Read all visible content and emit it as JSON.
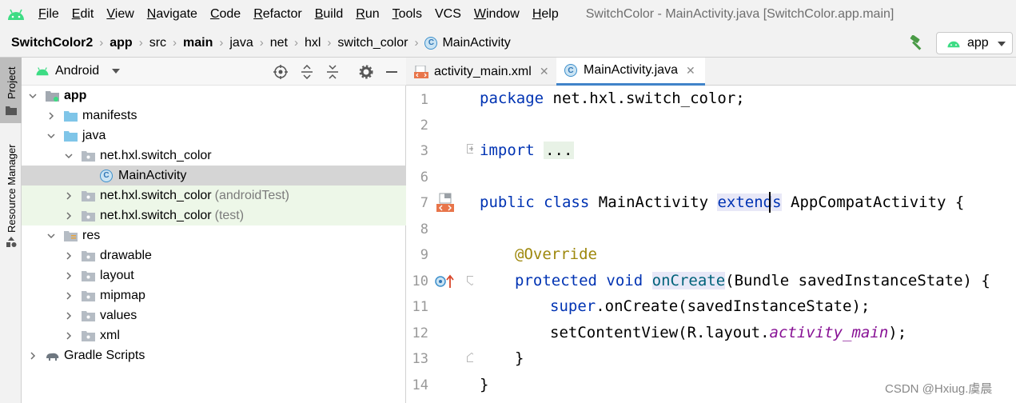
{
  "menubar": {
    "items": [
      "File",
      "Edit",
      "View",
      "Navigate",
      "Code",
      "Refactor",
      "Build",
      "Run",
      "Tools",
      "VCS",
      "Window",
      "Help"
    ],
    "mnemonics": [
      "F",
      "E",
      "V",
      "N",
      "C",
      "R",
      "B",
      "R",
      "T",
      "",
      "W",
      "H"
    ],
    "window_title": "SwitchColor - MainActivity.java [SwitchColor.app.main]"
  },
  "breadcrumb": {
    "items": [
      "SwitchColor2",
      "app",
      "src",
      "main",
      "java",
      "net",
      "hxl",
      "switch_color",
      "MainActivity"
    ],
    "run_config": "app"
  },
  "sidestrip": {
    "project": "Project",
    "resource_manager": "Resource Manager"
  },
  "project_panel": {
    "view": "Android",
    "tree": [
      {
        "label": "app",
        "suffix": "",
        "type": "module",
        "expanded": true
      },
      {
        "label": "manifests",
        "suffix": "",
        "type": "folder",
        "expanded": false
      },
      {
        "label": "java",
        "suffix": "",
        "type": "folder",
        "expanded": true
      },
      {
        "label": "net.hxl.switch_color",
        "suffix": "",
        "type": "package",
        "expanded": true
      },
      {
        "label": "MainActivity",
        "suffix": "",
        "type": "class",
        "selected": true
      },
      {
        "label": "net.hxl.switch_color",
        "suffix": "(androidTest)",
        "type": "package",
        "expanded": false
      },
      {
        "label": "net.hxl.switch_color",
        "suffix": "(test)",
        "type": "package",
        "expanded": false
      },
      {
        "label": "res",
        "suffix": "",
        "type": "res",
        "expanded": true
      },
      {
        "label": "drawable",
        "suffix": "",
        "type": "package",
        "expanded": false
      },
      {
        "label": "layout",
        "suffix": "",
        "type": "package",
        "expanded": false
      },
      {
        "label": "mipmap",
        "suffix": "",
        "type": "package",
        "expanded": false
      },
      {
        "label": "values",
        "suffix": "",
        "type": "package",
        "expanded": false
      },
      {
        "label": "xml",
        "suffix": "",
        "type": "package",
        "expanded": false
      },
      {
        "label": "Gradle Scripts",
        "suffix": "",
        "type": "gradle",
        "expanded": false
      }
    ]
  },
  "editor": {
    "tabs": [
      {
        "label": "activity_main.xml",
        "active": false
      },
      {
        "label": "MainActivity.java",
        "active": true
      }
    ],
    "line_numbers": [
      "1",
      "2",
      "3",
      "6",
      "7",
      "8",
      "9",
      "10",
      "11",
      "12",
      "13",
      "14"
    ],
    "code": {
      "l1_kw": "package",
      "l1_rest": " net.hxl.switch_color;",
      "l3_kw": "import",
      "l3_fold": "...",
      "l7_kw1": "public",
      "l7_kw2": "class",
      "l7_name": "MainActivity",
      "l7_ext": "extends",
      "l7_rest": " AppCompatActivity {",
      "l9_ann": "@Override",
      "l10_kw1": "protected",
      "l10_kw2": "void",
      "l10_mth": "onCreate",
      "l10_rest": "(Bundle savedInstanceState) {",
      "l11_kw": "super",
      "l11_rest": ".onCreate(savedInstanceState);",
      "l12_a": "setContentView(R.layout.",
      "l12_ital": "activity_main",
      "l12_b": ");",
      "l13": "}",
      "l14": "}"
    }
  },
  "watermark": "CSDN @Hxiug.虞晨",
  "colors": {
    "keyword": "#0033b3",
    "annotation": "#9e880d",
    "method": "#00627a",
    "field": "#871094",
    "selection": "#d5d5d5",
    "tab_underline": "#4083c9",
    "android_green": "#3ddc84"
  }
}
